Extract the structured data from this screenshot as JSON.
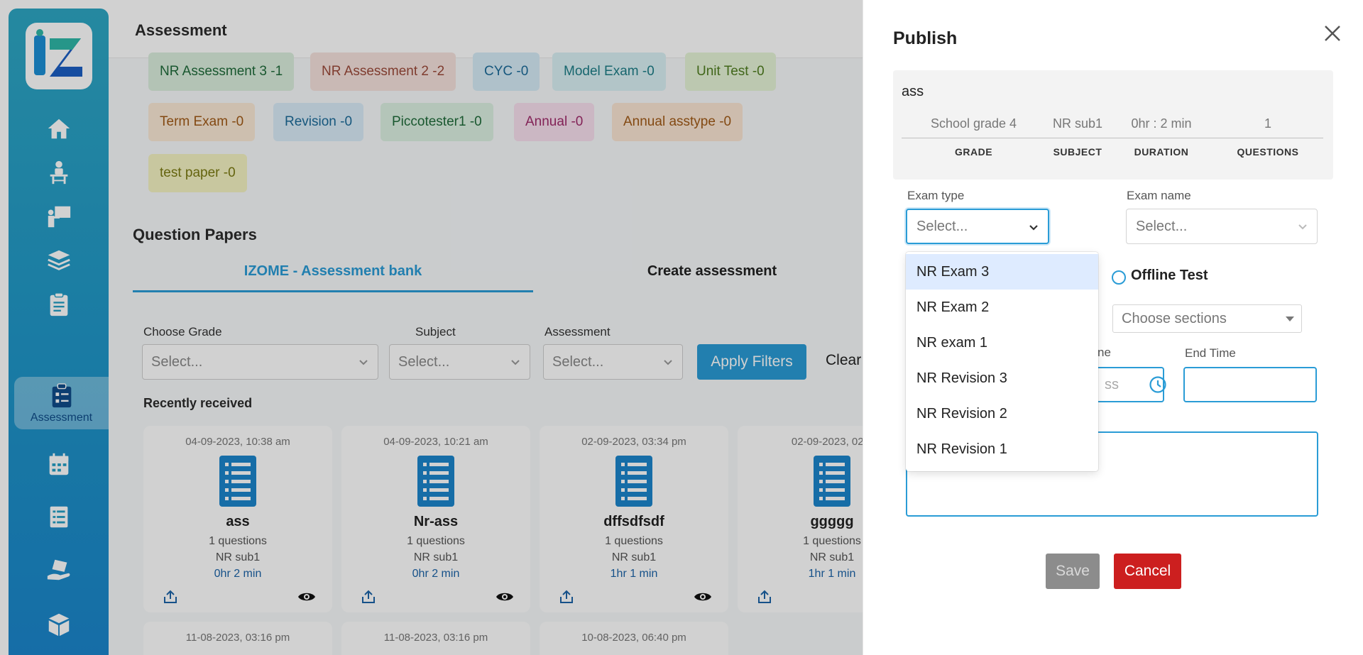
{
  "sidebar": {
    "items": [
      {
        "icon": "home-icon"
      },
      {
        "icon": "student-desk-icon"
      },
      {
        "icon": "teacher-board-icon"
      },
      {
        "icon": "books-icon"
      },
      {
        "icon": "clipboard-icon"
      },
      {
        "icon": "assessment-icon",
        "label": "Assessment",
        "active": true
      },
      {
        "icon": "calendar-icon"
      },
      {
        "icon": "checklist-icon"
      },
      {
        "icon": "hand-book-icon"
      },
      {
        "icon": "box-icon"
      }
    ]
  },
  "header": {
    "title": "Assessment"
  },
  "exam_type_chips": [
    {
      "label": "NR Assessment 3 -1",
      "bg": "#dbeedd",
      "fg": "#1f6b3a"
    },
    {
      "label": "NR Assessment 2 -2",
      "bg": "#f6e2dd",
      "fg": "#9b4a3a"
    },
    {
      "label": "CYC -0",
      "bg": "#d6ecf7",
      "fg": "#1c6b99"
    },
    {
      "label": "Model Exam -0",
      "bg": "#d9f1f4",
      "fg": "#1d7d87"
    },
    {
      "label": "Unit Test -0",
      "bg": "#e6f4d7",
      "fg": "#4f7d1f"
    },
    {
      "label": "Term Exam -0",
      "bg": "#fbe9d6",
      "fg": "#a05a16"
    },
    {
      "label": "Revision -0",
      "bg": "#d9ecf8",
      "fg": "#1c6b99"
    },
    {
      "label": "Piccotester1 -0",
      "bg": "#dcf1e2",
      "fg": "#1f6b3a"
    },
    {
      "label": "Annual -0",
      "bg": "#f8e0ee",
      "fg": "#a02b6b"
    },
    {
      "label": "Annual asstype -0",
      "bg": "#fbe6d4",
      "fg": "#a05a16"
    },
    {
      "label": "test paper -0",
      "bg": "#f5f3c2",
      "fg": "#7a7a12"
    }
  ],
  "question_papers": {
    "title": "Question Papers",
    "tabs": [
      {
        "label": "IZOME - Assessment bank",
        "active": true
      },
      {
        "label": "Create assessment",
        "active": false
      }
    ]
  },
  "filters": {
    "grade_label": "Choose Grade",
    "grade_placeholder": "Select...",
    "subject_label": "Subject",
    "subject_placeholder": "Select...",
    "assessment_label": "Assessment",
    "assessment_placeholder": "Select...",
    "apply_label": "Apply Filters",
    "clear_label": "Clear"
  },
  "recent": {
    "title": "Recently received",
    "cards": [
      {
        "date": "04-09-2023, 10:38 am",
        "name": "ass",
        "questions": "1 questions",
        "subject": "NR sub1",
        "duration": "0hr 2 min"
      },
      {
        "date": "04-09-2023, 10:21 am",
        "name": "Nr-ass",
        "questions": "1 questions",
        "subject": "NR sub1",
        "duration": "0hr 2 min"
      },
      {
        "date": "02-09-2023, 03:34 pm",
        "name": "dffsdfsdf",
        "questions": "1 questions",
        "subject": "NR sub1",
        "duration": "1hr 1 min"
      },
      {
        "date": "02-09-2023, 02:2",
        "name": "ggggg",
        "questions": "1 questions",
        "subject": "NR sub1",
        "duration": "1hr 1 min"
      }
    ],
    "second_row_dates": [
      "11-08-2023, 03:16 pm",
      "11-08-2023, 03:16 pm",
      "10-08-2023, 06:40 pm"
    ]
  },
  "publish": {
    "title": "Publish",
    "paper_name": "ass",
    "info": [
      {
        "value": "School grade 4",
        "key": "GRADE"
      },
      {
        "value": "NR sub1",
        "key": "SUBJECT"
      },
      {
        "value": "0hr : 2 min",
        "key": "DURATION"
      },
      {
        "value": "1",
        "key": "QUESTIONS"
      }
    ],
    "exam_type_label": "Exam type",
    "exam_type_placeholder": "Select...",
    "exam_name_label": "Exam name",
    "exam_name_placeholder": "Select...",
    "offline_label": "Offline Test",
    "sections_placeholder": "Choose sections",
    "start_time_label_partial": "ne",
    "start_time_value_partial": "ss",
    "end_time_label": "End Time",
    "save_label": "Save",
    "cancel_label": "Cancel",
    "exam_type_options": [
      {
        "label": "NR Exam 3",
        "highlighted": true
      },
      {
        "label": "NR Exam 2"
      },
      {
        "label": "NR exam 1"
      },
      {
        "label": "NR Revision 3"
      },
      {
        "label": "NR Revision 2"
      },
      {
        "label": "NR Revision 1"
      }
    ]
  },
  "colors": {
    "accent": "#2a9cd6",
    "danger": "#cc1f1f",
    "sidebar_top": "#2ea7c4",
    "sidebar_bottom": "#1b86cc"
  }
}
